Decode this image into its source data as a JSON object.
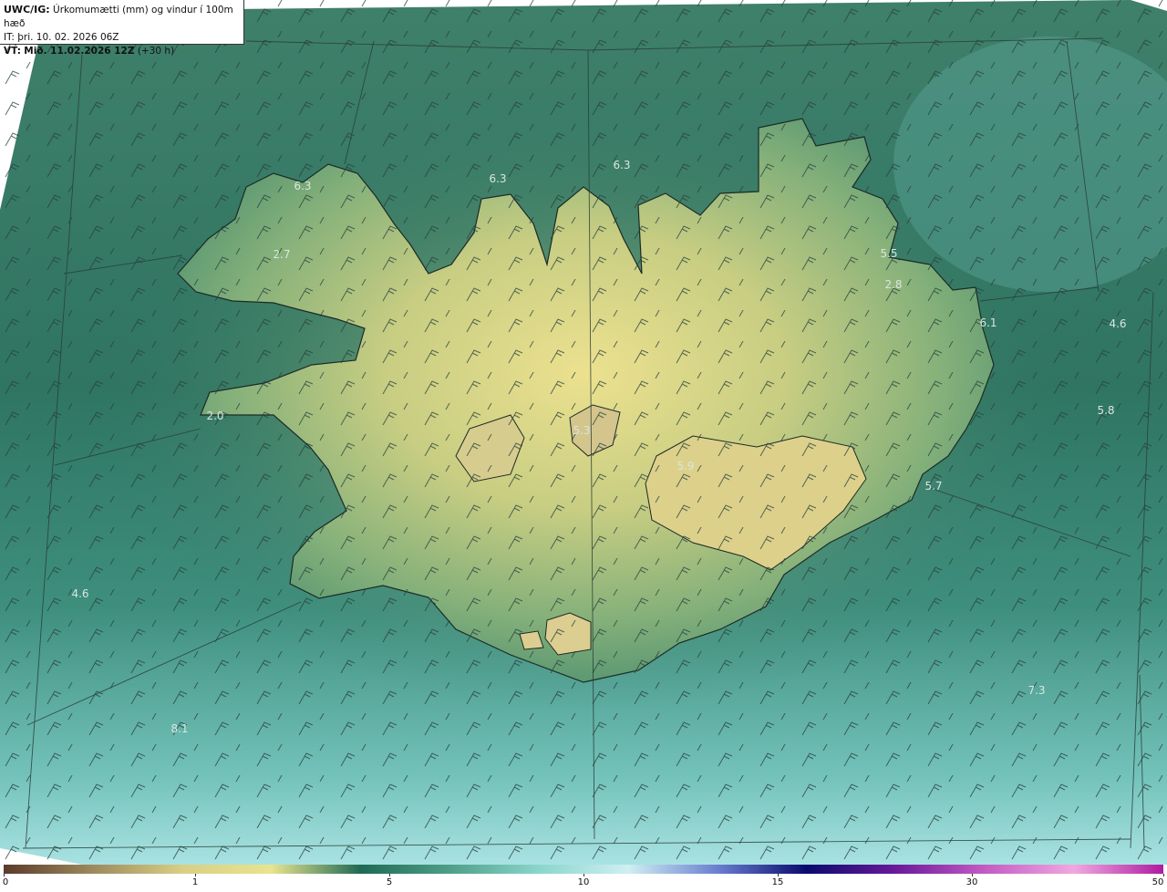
{
  "header": {
    "title_prefix": "UWC/IG:",
    "title_text": "Úrkomumætti (mm) og vindur í 100m hæð",
    "it_line": "IT: þri. 10. 02. 2026 06Z",
    "vt_prefix": "VT:",
    "vt_bold": "Mið. 11.02.2026 12Z",
    "vt_suffix": "(+30 h)"
  },
  "map_values": [
    "6.3",
    "6.3",
    "6.3",
    "2.7",
    "5.5",
    "2.8",
    "6.1",
    "4.6",
    "5.8",
    "5.7",
    "4.6",
    "7.3",
    "2.0",
    "5.3",
    "5.9",
    "8.1"
  ],
  "colorbar": {
    "ticks": [
      "0",
      "1",
      "5",
      "10",
      "15",
      "30",
      "50"
    ],
    "colors": [
      "#5a3b2b",
      "#9d8a5e",
      "#d8cf85",
      "#e9e48f",
      "#1f6a54",
      "#4f9f88",
      "#8ad6cc",
      "#cfeff2",
      "#6a7fd0",
      "#0a0a6e",
      "#6a1a9a",
      "#c45bc4",
      "#f0a8e0",
      "#b01aa0"
    ]
  }
}
